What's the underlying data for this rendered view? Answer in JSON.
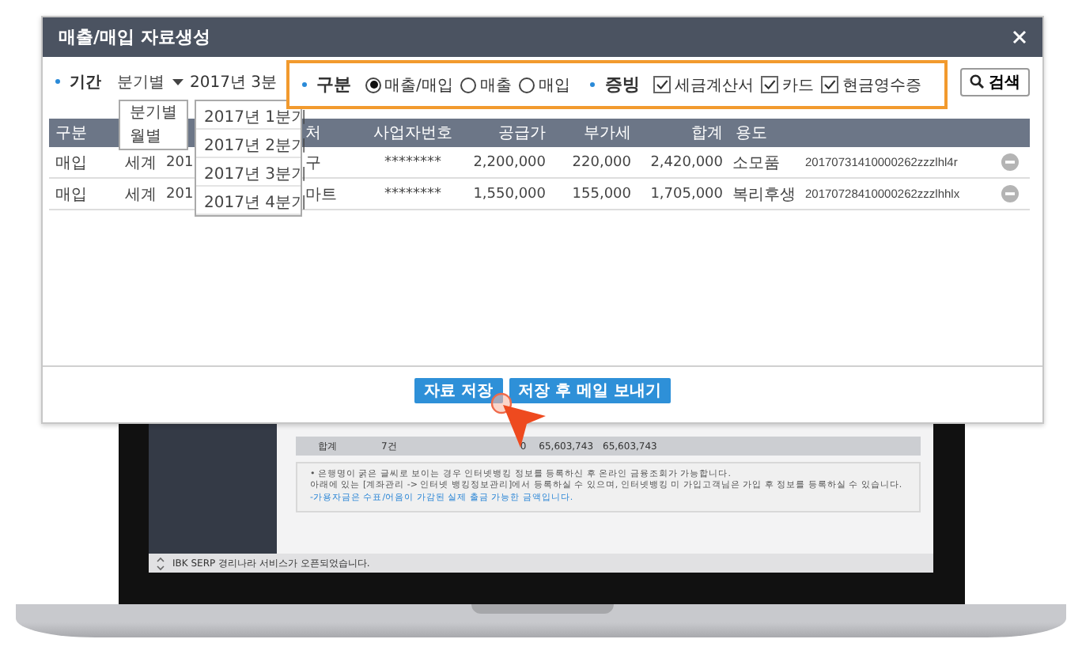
{
  "dialog": {
    "title": "매출/매입 자료생성"
  },
  "filters": {
    "period_label": "기간",
    "period_type": "분기별",
    "period_value": "2017년 3분"
  },
  "highlight": {
    "type_label": "구분",
    "type_options": [
      {
        "label": "매출/매입",
        "selected": true
      },
      {
        "label": "매출",
        "selected": false
      },
      {
        "label": "매입",
        "selected": false
      }
    ],
    "proof_label": "증빙",
    "proof_options": [
      {
        "label": "세금계산서",
        "checked": true
      },
      {
        "label": "카드",
        "checked": true
      },
      {
        "label": "현금영수증",
        "checked": true
      }
    ]
  },
  "search_button": "검색",
  "period_type_menu": [
    "분기별",
    "월별"
  ],
  "period_menu": [
    "2017년 1분기",
    "2017년 2분기",
    "2017년 3분기",
    "2017년 4분기"
  ],
  "table": {
    "columns": [
      "구분",
      "",
      "",
      "처",
      "사업자번호",
      "공급가",
      "부가세",
      "합계",
      "용도"
    ],
    "rows": [
      [
        "매입",
        "세계",
        "201",
        "구",
        "********",
        "2,200,000",
        "220,000",
        "2,420,000",
        "소모품",
        "20170731410000262zzzlhl4r"
      ],
      [
        "매입",
        "세계",
        "201",
        "마트",
        "********",
        "1,550,000",
        "155,000",
        "1,705,000",
        "복리후생",
        "20170728410000262zzzlhhlx"
      ]
    ]
  },
  "buttons": [
    "자료 저장",
    "저장 후 메일 보내기"
  ],
  "screen": {
    "total_row": [
      "합계",
      "7건",
      "0",
      "65,603,743",
      "65,603,743"
    ],
    "notes": [
      {
        "kind": "plain",
        "text": "• 은행명이 굵은 글씨로 보이는 경우 인터넷뱅킹 정보를 등록하신 후 온라인 금융조회가 가능합니다."
      },
      {
        "kind": "plain",
        "text": "아래에 있는 [계좌관리 -> 인터넷 뱅킹정보관리]에서 등록하실 수 있으며, 인터넷뱅킹 미 가입고객님은 가입 후 정보를 등록하실 수 있습니다."
      },
      {
        "kind": "highlight",
        "text": "-가용자금은 수표/어음이 가감된 실제 출금 가능한 금액입니다."
      }
    ],
    "status": "IBK SERP 경리나라 서비스가 오픈되었습니다."
  }
}
